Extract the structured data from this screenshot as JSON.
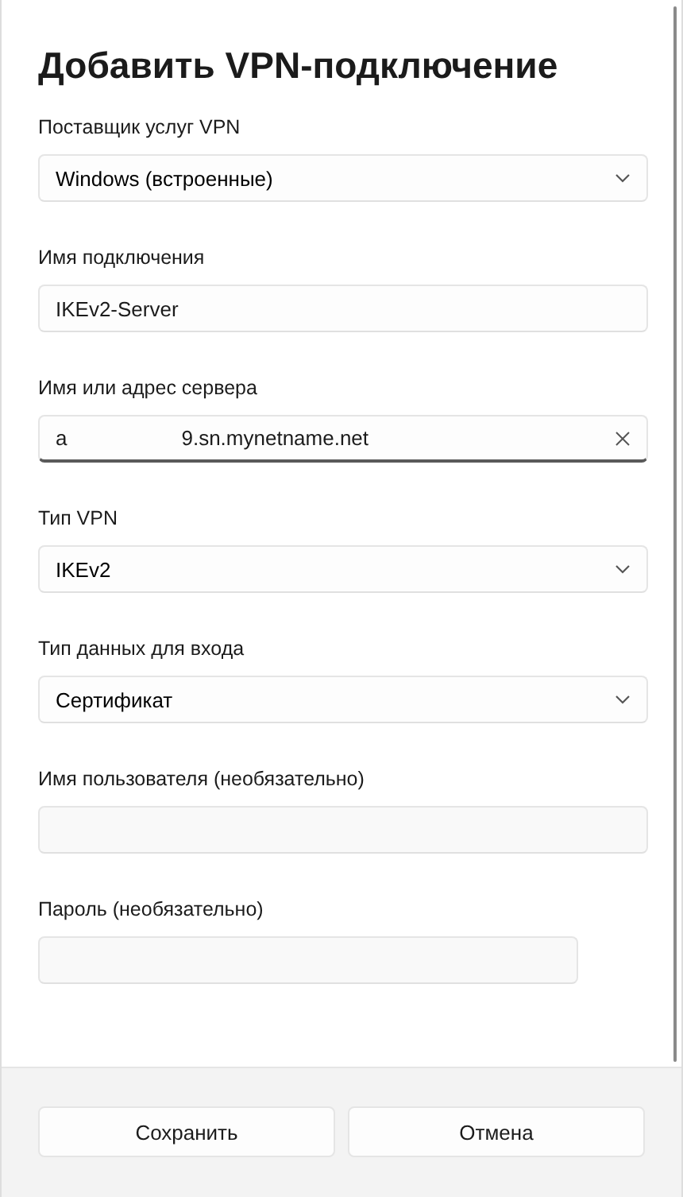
{
  "dialog": {
    "title": "Добавить VPN-подключение"
  },
  "fields": [
    {
      "kind": "dropdown",
      "label": "Поставщик услуг VPN",
      "value": "Windows (встроенные)",
      "focused": false
    },
    {
      "kind": "text",
      "label": "Имя подключения",
      "value_parts": [
        "IKEv2-Server"
      ],
      "focused": false
    },
    {
      "kind": "text",
      "label": "Имя или адрес сервера",
      "value_parts": [
        "a",
        "9.sn.mynetname.net"
      ],
      "focused": true
    },
    {
      "kind": "dropdown",
      "label": "Тип VPN",
      "value": "IKEv2",
      "focused": false
    },
    {
      "kind": "dropdown",
      "label": "Тип данных для входа",
      "value": "Сертификат",
      "focused": false
    },
    {
      "kind": "text",
      "label": "Имя пользователя (необязательно)",
      "focused": false
    },
    {
      "kind": "password",
      "label": "Пароль (необязательно)",
      "focused": false
    }
  ],
  "buttons": [
    "Сохранить",
    "Отмена"
  ]
}
